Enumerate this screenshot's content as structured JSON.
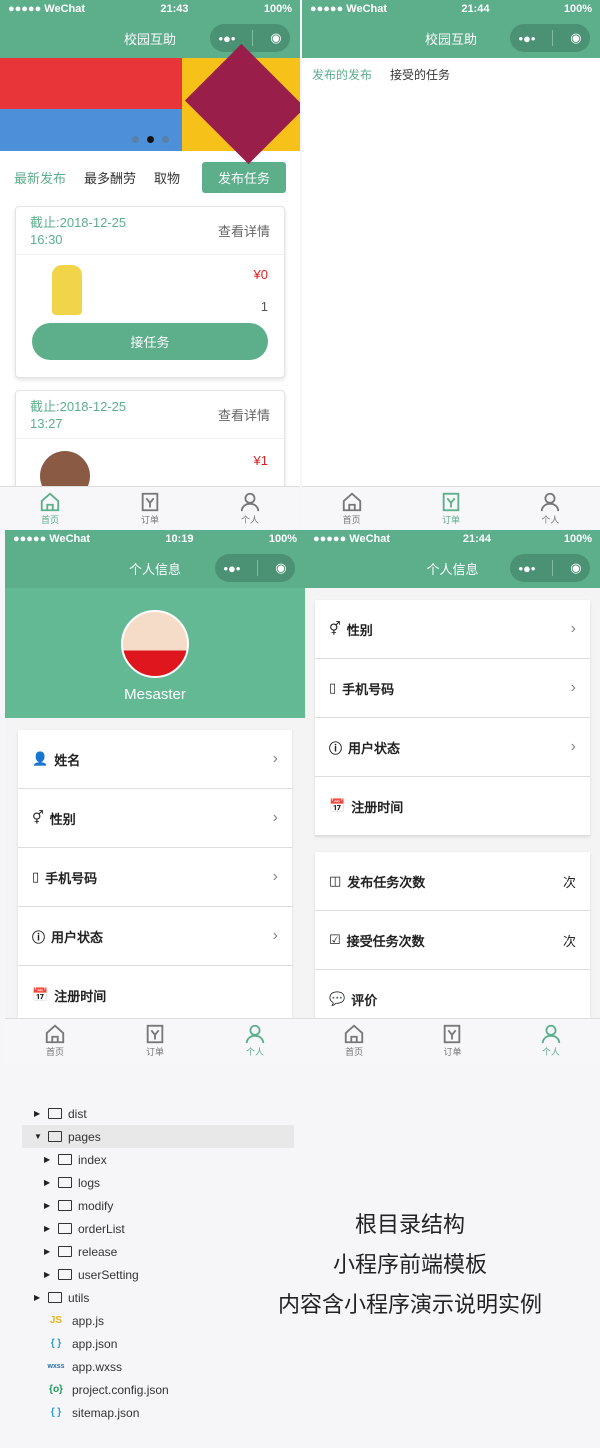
{
  "screens": [
    {
      "status": {
        "carrier": "●●●●● WeChat",
        "time": "21:43",
        "battery": "100%"
      },
      "title": "校园互助"
    },
    {
      "status": {
        "carrier": "●●●●● WeChat",
        "time": "21:44",
        "battery": "100%"
      },
      "title": "校园互助"
    },
    {
      "status": {
        "carrier": "●●●●● WeChat",
        "time": "10:19",
        "battery": "100%"
      },
      "title": "个人信息"
    },
    {
      "status": {
        "carrier": "●●●●● WeChat",
        "time": "21:44",
        "battery": "100%"
      },
      "title": "个人信息"
    }
  ],
  "home": {
    "filters": [
      "最新发布",
      "最多酬劳",
      "取物"
    ],
    "publish_button": "发布任务",
    "tasks": [
      {
        "deadline": "截止:2018-12-25",
        "time": "16:30",
        "detail": "查看详情",
        "price": "¥0",
        "count": "1",
        "accept": "接任务"
      },
      {
        "deadline": "截止:2018-12-25",
        "time": "13:27",
        "detail": "查看详情",
        "price": "¥1"
      }
    ]
  },
  "orders": {
    "tabs": [
      "发布的发布",
      "接受的任务"
    ]
  },
  "tabbar": {
    "home": "首页",
    "orders": "订单",
    "me": "个人"
  },
  "profile": {
    "username": "Mesaster",
    "fields": [
      "姓名",
      "性别",
      "手机号码",
      "用户状态",
      "注册时间"
    ],
    "stats": [
      {
        "label": "发布任务次数",
        "unit": "次"
      },
      {
        "label": "接受任务次数",
        "unit": "次"
      },
      {
        "label": "评价"
      }
    ]
  },
  "tree": {
    "items": [
      {
        "name": "dist",
        "type": "folder",
        "depth": 0
      },
      {
        "name": "pages",
        "type": "folder-open",
        "depth": 0
      },
      {
        "name": "index",
        "type": "folder",
        "depth": 1
      },
      {
        "name": "logs",
        "type": "folder",
        "depth": 1
      },
      {
        "name": "modify",
        "type": "folder",
        "depth": 1
      },
      {
        "name": "orderList",
        "type": "folder",
        "depth": 1
      },
      {
        "name": "release",
        "type": "folder",
        "depth": 1
      },
      {
        "name": "userSetting",
        "type": "folder",
        "depth": 1
      },
      {
        "name": "utils",
        "type": "folder",
        "depth": 0
      },
      {
        "name": "app.js",
        "type": "js",
        "badge": "JS"
      },
      {
        "name": "app.json",
        "type": "json",
        "badge": "{ }"
      },
      {
        "name": "app.wxss",
        "type": "wxss",
        "badge": "wxss"
      },
      {
        "name": "project.config.json",
        "type": "config",
        "badge": "{o}"
      },
      {
        "name": "sitemap.json",
        "type": "json",
        "badge": "{ }"
      }
    ]
  },
  "caption": [
    "根目录结构",
    "小程序前端模板",
    "内容含小程序演示说明实例"
  ],
  "colors": {
    "accent": "#5dae8b",
    "price": "#e02020"
  }
}
